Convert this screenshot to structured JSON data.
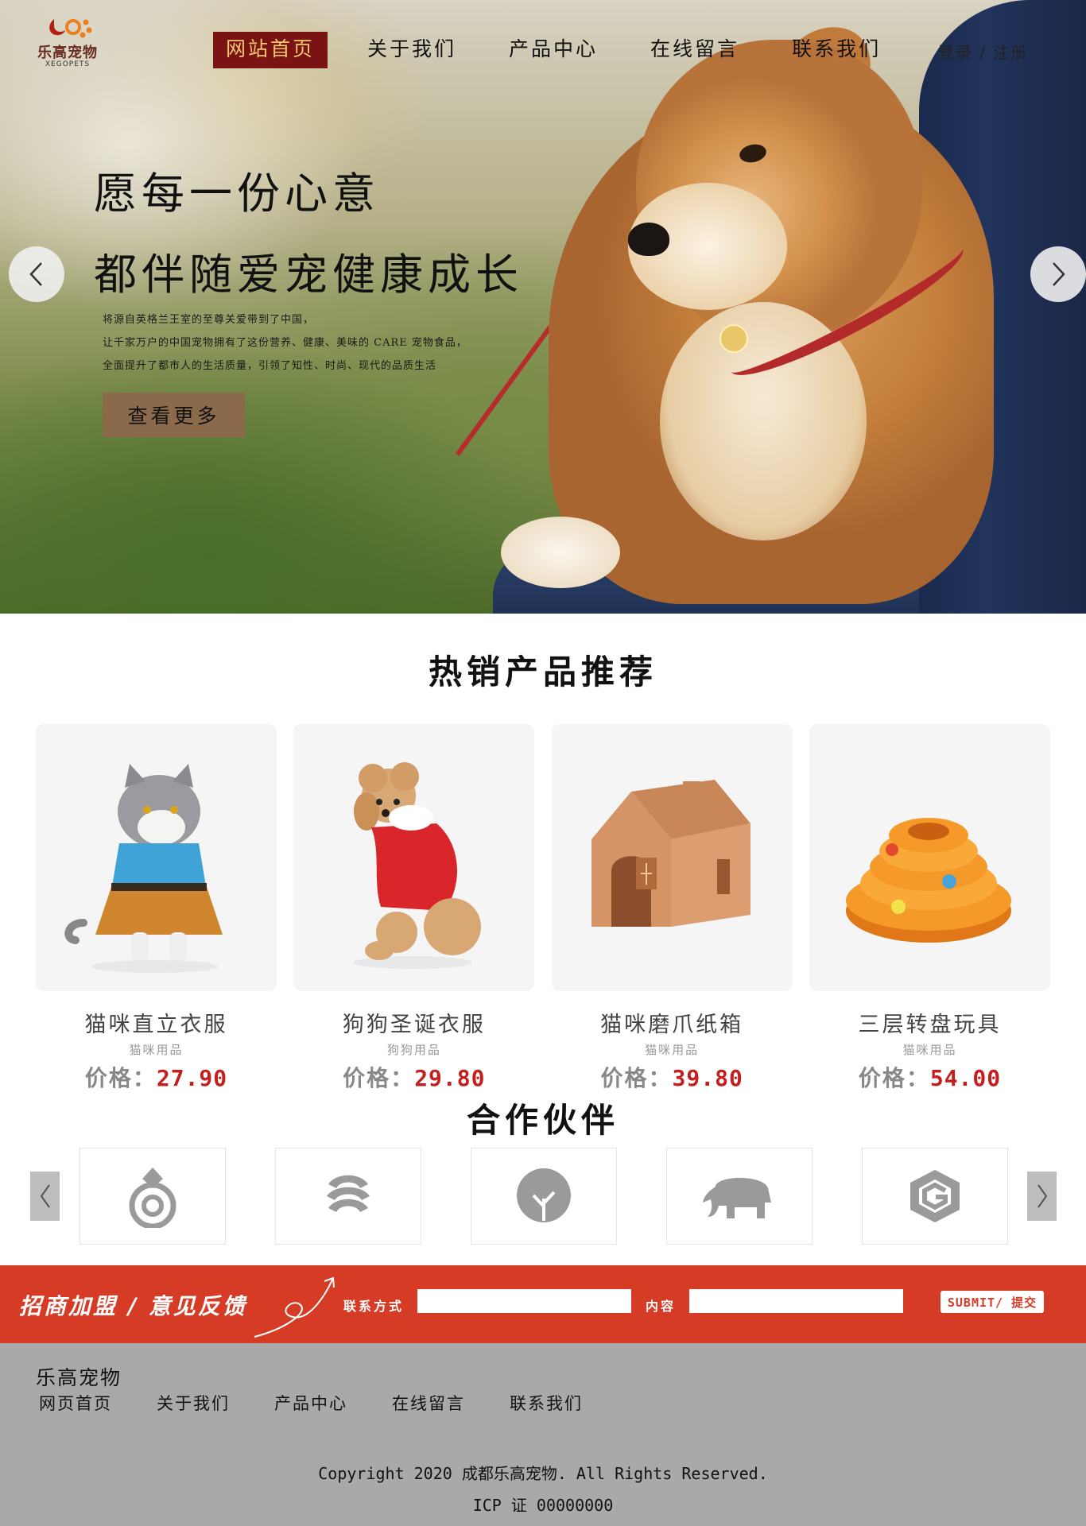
{
  "logo": {
    "name": "乐高宠物",
    "sub": "XEGOPETS"
  },
  "nav": [
    {
      "label": "网站首页",
      "active": true
    },
    {
      "label": "关于我们",
      "active": false
    },
    {
      "label": "产品中心",
      "active": false
    },
    {
      "label": "在线留言",
      "active": false
    },
    {
      "label": "联系我们",
      "active": false
    }
  ],
  "login": "登录 / 注册",
  "hero": {
    "line1": "愿每一份心意",
    "line2": "都伴随爱宠健康成长",
    "desc": [
      "将源自英格兰王室的至尊关爱带到了中国，",
      "让千家万户的中国宠物拥有了这份营养、健康、美味的 CARE 宠物食品，",
      "全面提升了都市人的生活质量，引领了知性、时尚、现代的品质生活"
    ],
    "button": "查看更多"
  },
  "products": {
    "title": "热销产品推荐",
    "price_label": "价格：",
    "items": [
      {
        "name": "猫咪直立衣服",
        "category": "猫咪用品",
        "price": "27.90"
      },
      {
        "name": "狗狗圣诞衣服",
        "category": "狗狗用品",
        "price": "29.80"
      },
      {
        "name": "猫咪磨爪纸箱",
        "category": "猫咪用品",
        "price": "39.80"
      },
      {
        "name": "三层转盘玩具",
        "category": "猫咪用品",
        "price": "54.00"
      }
    ]
  },
  "partners": {
    "title": "合作伙伴",
    "logos": [
      "drop-ring-logo-icon",
      "stripe-swirl-logo-icon",
      "tree-logo-icon",
      "elephant-logo-icon",
      "hex-g-logo-icon"
    ]
  },
  "feedback": {
    "title": "招商加盟 / 意见反馈",
    "contact_label": "联系方式",
    "content_label": "内容",
    "contact_value": "",
    "content_value": "",
    "submit": "SUBMIT/ 提交"
  },
  "footer": {
    "brand": "乐高宠物",
    "links": [
      "网页首页",
      "关于我们",
      "产品中心",
      "在线留言",
      "联系我们"
    ],
    "copyright": "Copyright 2020 成都乐高宠物. All Rights Reserved.",
    "icp": "ICP 证 00000000"
  },
  "colors": {
    "nav_active_bg": "#7a1414",
    "nav_active_text": "#f3c96c",
    "price": "#c41e1e",
    "feedback_bg": "#d63b26",
    "footer_bg": "#a9a9a9",
    "hero_button": "#8b6a4b"
  }
}
